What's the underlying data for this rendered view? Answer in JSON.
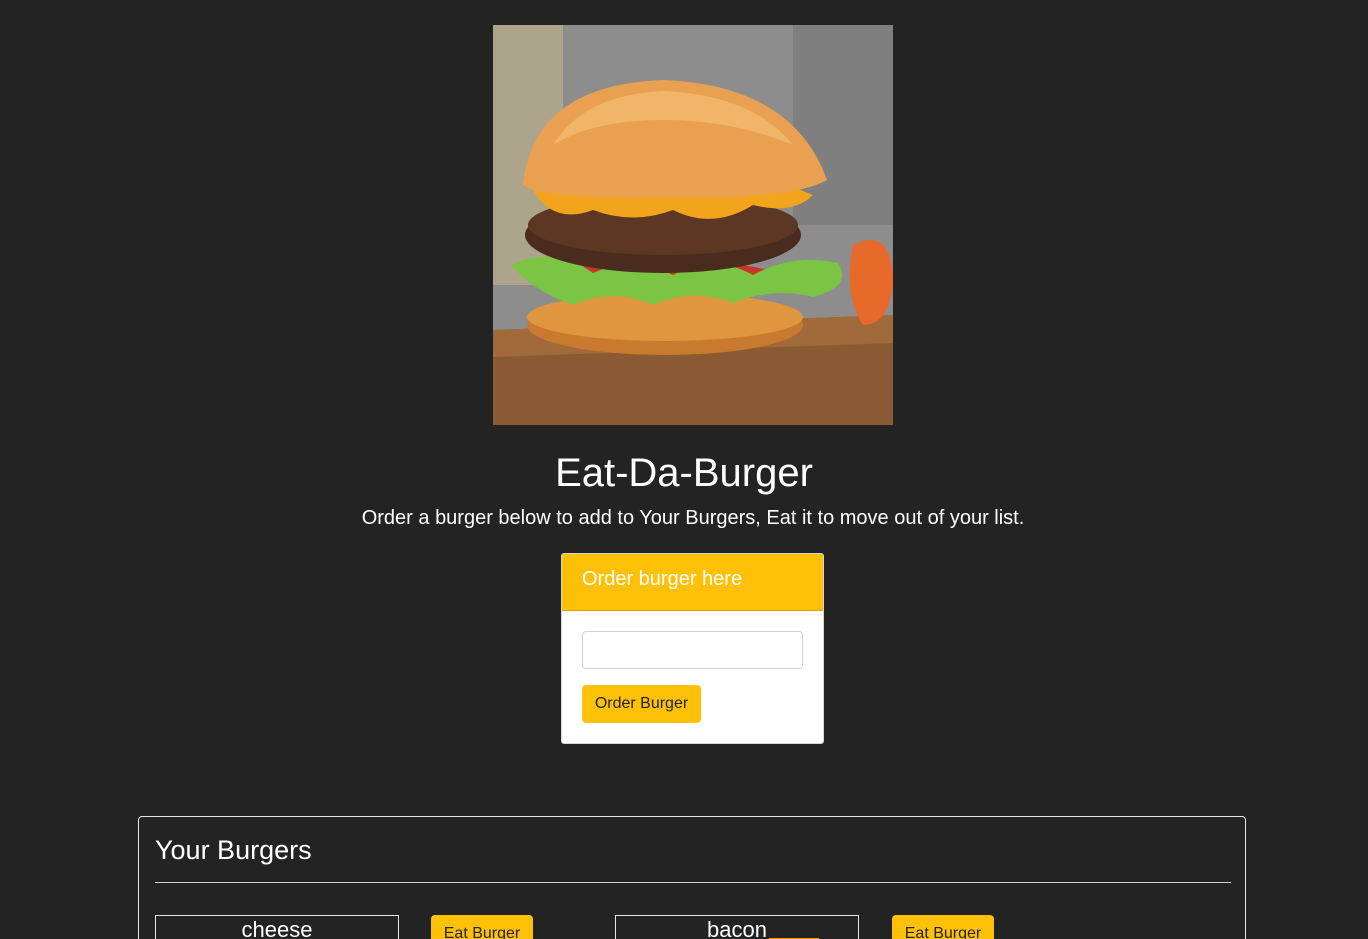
{
  "hero": {
    "image_icon": "burger-photo-icon"
  },
  "header": {
    "title": "Eat-Da-Burger",
    "subtitle": "Order a burger below to add to Your Burgers, Eat it to move out of your list."
  },
  "order_card": {
    "header": "Order burger here",
    "input_value": "",
    "input_placeholder": "",
    "button_label": "Order Burger"
  },
  "your_burgers": {
    "title": "Your Burgers",
    "items": [
      {
        "name": "cheese",
        "button_label": "Eat Burger"
      },
      {
        "name": "bacon",
        "button_label": "Eat Burger"
      }
    ]
  },
  "colors": {
    "background": "#232323",
    "accent": "#ffc107",
    "text": "#ffffff"
  }
}
